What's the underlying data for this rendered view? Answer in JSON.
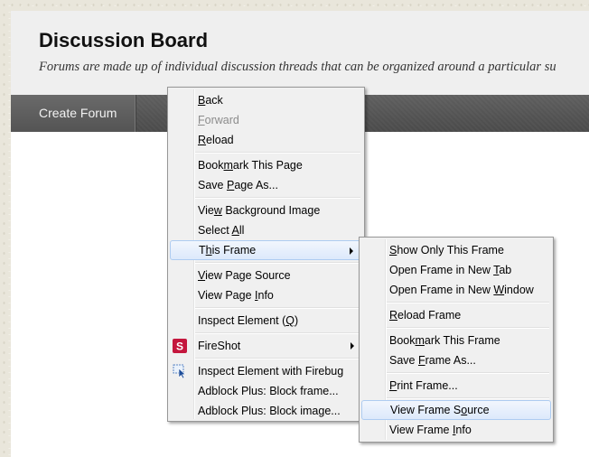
{
  "page": {
    "title": "Discussion Board",
    "description": "Forums are made up of individual discussion threads that can be organized around a particular su",
    "action_button": "Create Forum"
  },
  "context_menu": {
    "items": [
      {
        "pre": "",
        "key": "B",
        "post": "ack",
        "disabled": false
      },
      {
        "pre": "",
        "key": "F",
        "post": "orward",
        "disabled": true
      },
      {
        "pre": "",
        "key": "R",
        "post": "eload",
        "disabled": false
      },
      {
        "pre": "Book",
        "key": "m",
        "post": "ark This Page",
        "disabled": false
      },
      {
        "pre": "Save ",
        "key": "P",
        "post": "age As...",
        "disabled": false
      },
      {
        "pre": "Vie",
        "key": "w",
        "post": " Background Image",
        "disabled": false
      },
      {
        "pre": "Select ",
        "key": "A",
        "post": "ll",
        "disabled": false
      },
      {
        "pre": "T",
        "key": "h",
        "post": "is Frame",
        "disabled": false
      },
      {
        "pre": "",
        "key": "V",
        "post": "iew Page Source",
        "disabled": false
      },
      {
        "pre": "View Page ",
        "key": "I",
        "post": "nfo",
        "disabled": false
      },
      {
        "pre": "Inspect Element (",
        "key": "Q",
        "post": ")",
        "disabled": false
      },
      {
        "pre": "FireShot",
        "key": "",
        "post": "",
        "disabled": false
      },
      {
        "pre": "Inspect Element with Firebug",
        "key": "",
        "post": "",
        "disabled": false
      },
      {
        "pre": "Adblock Plus: Block frame...",
        "key": "",
        "post": "",
        "disabled": false
      },
      {
        "pre": "Adblock Plus: Block image...",
        "key": "",
        "post": "",
        "disabled": false
      }
    ]
  },
  "submenu": {
    "items": [
      {
        "pre": "",
        "key": "S",
        "post": "how Only This Frame"
      },
      {
        "pre": "Open Frame in New ",
        "key": "T",
        "post": "ab"
      },
      {
        "pre": "Open Frame in New ",
        "key": "W",
        "post": "indow"
      },
      {
        "pre": "",
        "key": "R",
        "post": "eload Frame"
      },
      {
        "pre": "Book",
        "key": "m",
        "post": "ark This Frame"
      },
      {
        "pre": "Save ",
        "key": "F",
        "post": "rame As..."
      },
      {
        "pre": "",
        "key": "P",
        "post": "rint Frame..."
      },
      {
        "pre": "View Frame S",
        "key": "o",
        "post": "urce"
      },
      {
        "pre": "View Frame ",
        "key": "I",
        "post": "nfo"
      }
    ]
  },
  "icons": {
    "fireshot_color": "#c4163d",
    "firebug_icon": "inspect-cursor-icon"
  }
}
